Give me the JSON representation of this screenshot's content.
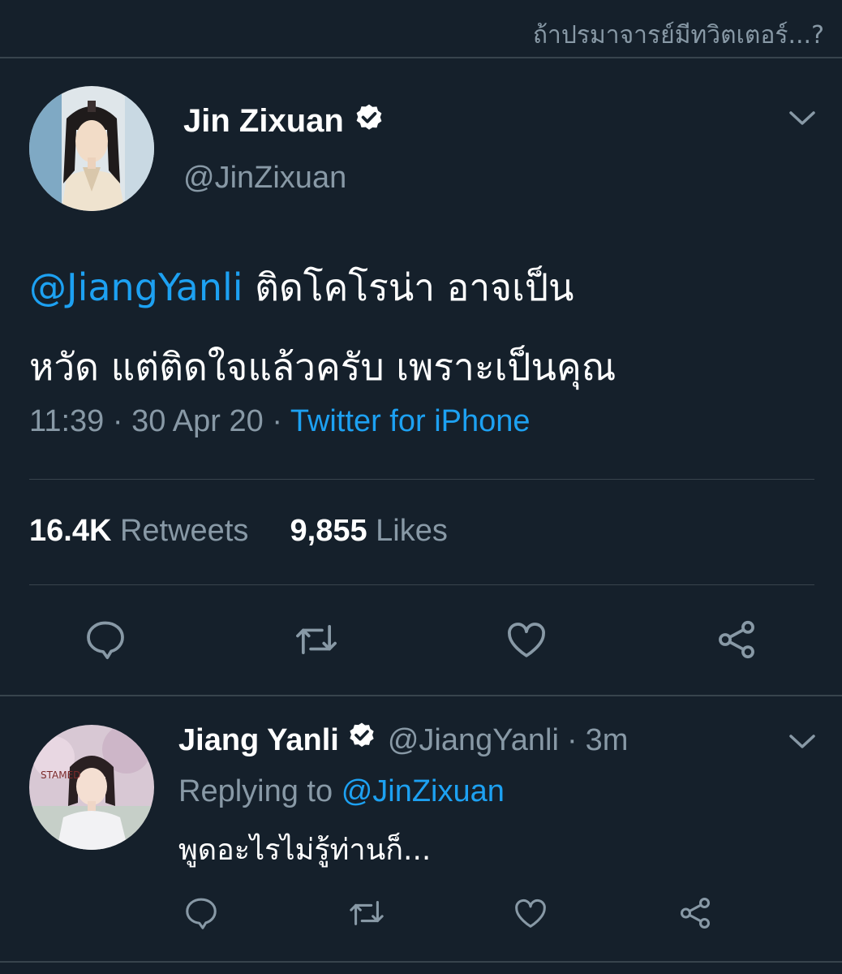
{
  "header": {
    "caption": "ถ้าปรมาจารย์มีทวิตเตอร์...?"
  },
  "main_tweet": {
    "display_name": "Jin Zixuan",
    "handle": "@JinZixuan",
    "mention": "@JiangYanli",
    "text_line1_rest": " ติดโคโรน่า อาจเป็น",
    "text_line2": "หวัด แต่ติดใจแล้วครับ เพราะเป็นคุณ",
    "time": "11:39",
    "date": "30 Apr 20",
    "source": "Twitter for iPhone",
    "retweets_count": "16.4K",
    "retweets_label": "Retweets",
    "likes_count": "9,855",
    "likes_label": "Likes",
    "icons": [
      "verified-badge-icon",
      "chevron-down-icon",
      "reply-icon",
      "retweet-icon",
      "like-icon",
      "share-icon"
    ]
  },
  "reply_tweet": {
    "display_name": "Jiang Yanli",
    "handle": "@JiangYanli",
    "separator": "·",
    "age": "3m",
    "replying_label": "Replying to",
    "replying_to": "@JinZixuan",
    "text": "พูดอะไรไม่รู้ท่านก็..."
  },
  "colors": {
    "background": "#15202b",
    "accent": "#1da1f2",
    "secondary_text": "#8899a6",
    "divider": "#38444d"
  }
}
